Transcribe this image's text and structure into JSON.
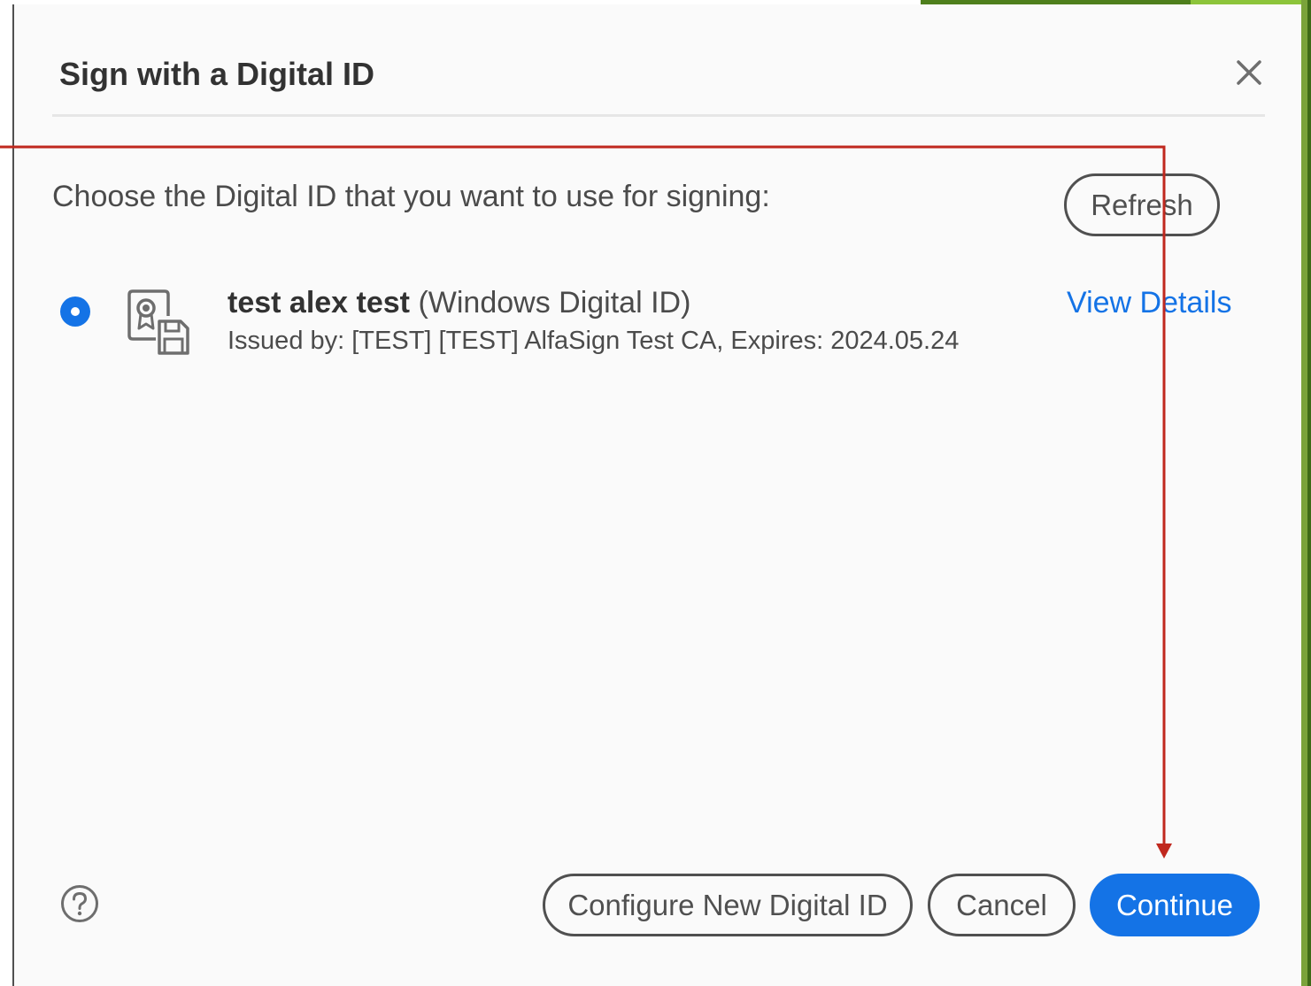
{
  "dialog": {
    "title": "Sign with a Digital ID",
    "close_icon": "close-icon",
    "prompt": "Choose the Digital ID that you want to use for signing:",
    "refresh_label": "Refresh"
  },
  "digital_ids": [
    {
      "name": "test alex test",
      "type": "(Windows Digital ID)",
      "issuer_line": "Issued by: [TEST] [TEST] AlfaSign Test CA, Expires: 2024.05.24",
      "selected": true,
      "icon": "certificate-save-icon",
      "view_details_label": "View Details"
    }
  ],
  "footer": {
    "help_icon": "help-icon",
    "configure_label": "Configure New Digital ID",
    "cancel_label": "Cancel",
    "continue_label": "Continue"
  },
  "colors": {
    "accent": "#1473e6",
    "annotation_arrow": "#c0281e",
    "title_text": "#323232",
    "body_text": "#4b4b4b",
    "dialog_bg": "#fafafa"
  }
}
